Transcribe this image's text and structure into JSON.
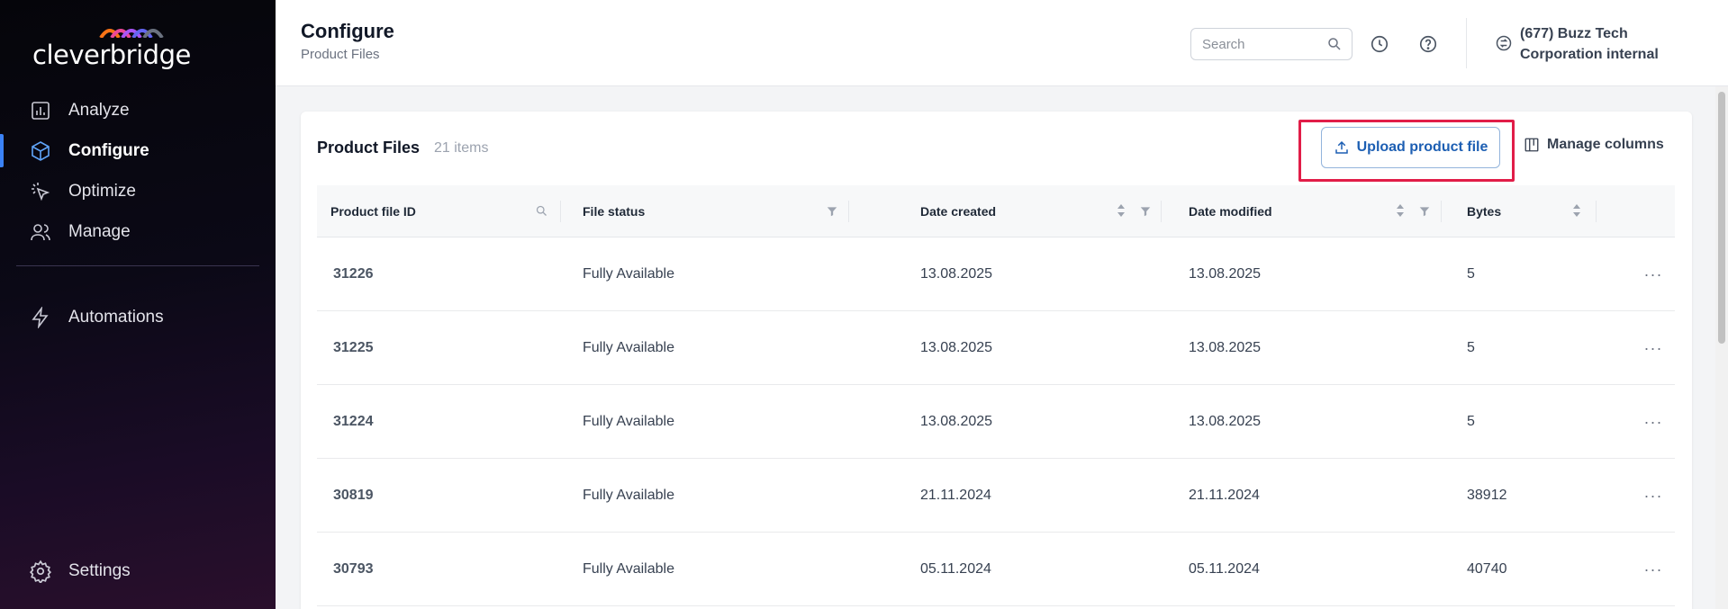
{
  "app": {
    "brand": "cleverbridge"
  },
  "sidebar": {
    "items": [
      {
        "label": "Analyze",
        "icon": "bar-chart-icon",
        "active": false
      },
      {
        "label": "Configure",
        "icon": "cube-icon",
        "active": true
      },
      {
        "label": "Optimize",
        "icon": "cursor-click-icon",
        "active": false
      },
      {
        "label": "Manage",
        "icon": "users-icon",
        "active": false
      }
    ],
    "automations": {
      "label": "Automations",
      "icon": "lightning-icon"
    },
    "settings": {
      "label": "Settings",
      "icon": "gear-icon"
    }
  },
  "header": {
    "title": "Configure",
    "subtitle": "Product Files",
    "search_placeholder": "Search",
    "account": "(677) Buzz Tech Corporation internal"
  },
  "card": {
    "title": "Product Files",
    "count": "21 items",
    "upload_label": "Upload product file",
    "manage_columns_label": "Manage columns"
  },
  "table": {
    "columns": [
      "Product file ID",
      "File status",
      "Date created",
      "Date modified",
      "Bytes"
    ],
    "rows": [
      {
        "id": "31226",
        "status": "Fully Available",
        "created": "13.08.2025",
        "modified": "13.08.2025",
        "bytes": "5"
      },
      {
        "id": "31225",
        "status": "Fully Available",
        "created": "13.08.2025",
        "modified": "13.08.2025",
        "bytes": "5"
      },
      {
        "id": "31224",
        "status": "Fully Available",
        "created": "13.08.2025",
        "modified": "13.08.2025",
        "bytes": "5"
      },
      {
        "id": "30819",
        "status": "Fully Available",
        "created": "21.11.2024",
        "modified": "21.11.2024",
        "bytes": "38912"
      },
      {
        "id": "30793",
        "status": "Fully Available",
        "created": "05.11.2024",
        "modified": "05.11.2024",
        "bytes": "40740"
      }
    ]
  },
  "colors": {
    "accent": "#1d5fb3",
    "highlight": "#e11d48",
    "active_indicator": "#3b82f6"
  }
}
